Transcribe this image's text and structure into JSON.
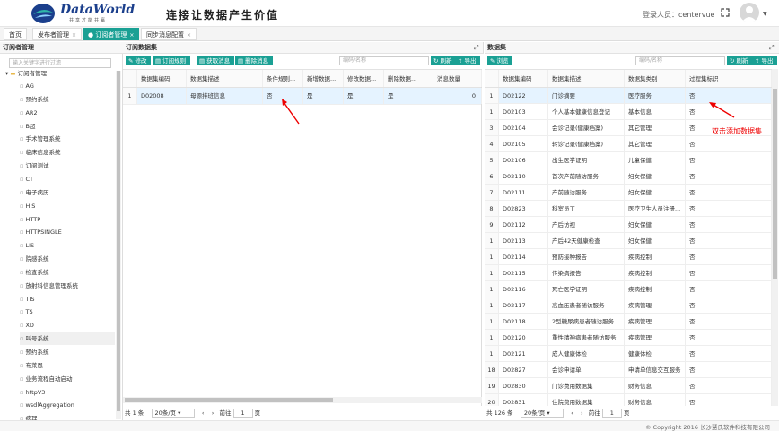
{
  "header": {
    "brand": "DataWorld",
    "brand_sub": "共享才能共赢",
    "slogan": "连接让数据产生价值",
    "login_label": "登录人员：centervue"
  },
  "tabs": [
    "首页",
    "发布者管理",
    "订阅者管理",
    "同步消息配置"
  ],
  "tree": {
    "title": "订阅者管理",
    "search_placeholder": "输入关键字进行过滤",
    "root": "订阅者管理",
    "items": [
      "AG",
      "预约系统",
      "AR2",
      "B超",
      "手术管理系统",
      "临床信息系统",
      "订阅测试",
      "CT",
      "电子病历",
      "HIS",
      "HTTP",
      "HTTPSINGLE",
      "LIS",
      "院感系统",
      "检查系统",
      "放射科信息管理系统",
      "TIS",
      "TS",
      "XD",
      "叫号系统",
      "预约系统",
      "布莱恩",
      "业务流程自动启动",
      "httpV3",
      "wsdlAggregation",
      "病理"
    ]
  },
  "left": {
    "title": "订阅数据集",
    "buttons": [
      "修改",
      "订阅规则",
      "获取消息",
      "删除消息"
    ],
    "search_placeholder": "编码/名称",
    "refresh": "刷新",
    "export": "导出",
    "columns": [
      "数据集编码",
      "数据集描述",
      "条件规则...",
      "新增数据...",
      "修改数据...",
      "删除数据...",
      "消息数量"
    ],
    "rows": [
      [
        "1",
        "D02008",
        "母源排班信息",
        "否",
        "是",
        "是",
        "是",
        "0"
      ]
    ],
    "pager": {
      "total": "共 1 条",
      "size": "20条/页",
      "goto": "前往",
      "page": "1",
      "unit": "页"
    }
  },
  "right": {
    "title": "数据集",
    "buttons": [
      "浏览"
    ],
    "search_placeholder": "编码/名称",
    "refresh": "刷新",
    "export": "导出",
    "columns": [
      "数据集编码",
      "数据集描述",
      "数据集类别",
      "过程集标识"
    ],
    "rows": [
      [
        "1",
        "D02122",
        "门诊摘要",
        "医疗服务",
        "否"
      ],
      [
        "1",
        "D02103",
        "个人基本健康信息登记",
        "基本信息",
        "否"
      ],
      [
        "3",
        "D02104",
        "会诊记录(健康档案)",
        "其它管理",
        "否"
      ],
      [
        "4",
        "D02105",
        "转诊记录(健康档案)",
        "其它管理",
        "否"
      ],
      [
        "5",
        "D02106",
        "出生医学证明",
        "儿童保健",
        "否"
      ],
      [
        "6",
        "D02110",
        "首次产前随访服务",
        "妇女保健",
        "否"
      ],
      [
        "7",
        "D02111",
        "产前随访服务",
        "妇女保健",
        "否"
      ],
      [
        "8",
        "D02823",
        "科室员工",
        "医疗卫生人员注册...",
        "否"
      ],
      [
        "9",
        "D02112",
        "产后访视",
        "妇女保健",
        "否"
      ],
      [
        "1",
        "D02113",
        "产后42天健康检查",
        "妇女保健",
        "否"
      ],
      [
        "1",
        "D02114",
        "预防接种报告",
        "疾病控制",
        "否"
      ],
      [
        "1",
        "D02115",
        "传染病报告",
        "疾病控制",
        "否"
      ],
      [
        "1",
        "D02116",
        "死亡医学证明",
        "疾病控制",
        "否"
      ],
      [
        "1",
        "D02117",
        "高血压患者随访服务",
        "疾病管理",
        "否"
      ],
      [
        "1",
        "D02118",
        "2型糖尿病患者随访服务",
        "疾病管理",
        "否"
      ],
      [
        "1",
        "D02120",
        "重性精神病患者随访服务",
        "疾病管理",
        "否"
      ],
      [
        "1",
        "D02121",
        "成人健康体检",
        "健康体检",
        "否"
      ],
      [
        "18",
        "D02827",
        "会诊申请单",
        "申请单信息交互服务",
        "否"
      ],
      [
        "19",
        "D02830",
        "门诊费用数据集",
        "财务信息",
        "否"
      ],
      [
        "20",
        "D02831",
        "住院费用数据集",
        "财务信息",
        "否"
      ]
    ],
    "pager": {
      "total": "共 126 条",
      "size": "20条/页",
      "goto": "前往",
      "page": "1",
      "unit": "页"
    }
  },
  "annotations": {
    "right": "双击添加数据集"
  },
  "footer": "© Copyright 2016 长沙慧氏软件科技有限公司",
  "colors": {
    "accent": "#1aa094",
    "annotation": "#e00000",
    "selected_row": "#e5f3ff"
  }
}
